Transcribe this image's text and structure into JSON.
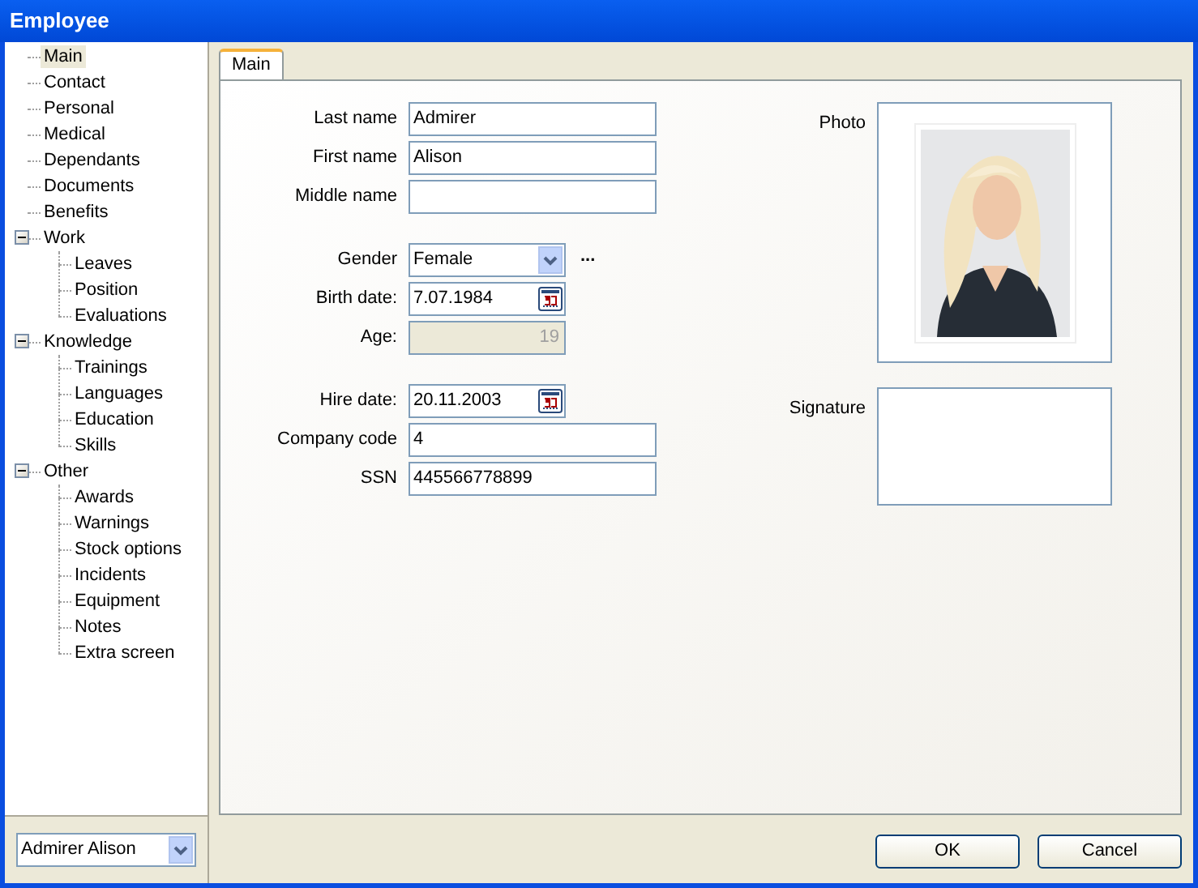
{
  "window": {
    "title": "Employee"
  },
  "tree": [
    {
      "label": "Main",
      "selected": true
    },
    {
      "label": "Contact",
      "selected": false
    },
    {
      "label": "Personal",
      "selected": false
    },
    {
      "label": "Medical",
      "selected": false
    },
    {
      "label": "Dependants",
      "selected": false
    },
    {
      "label": "Documents",
      "selected": false
    },
    {
      "label": "Benefits",
      "selected": false
    },
    {
      "label": "Work",
      "selected": false,
      "expanded": true,
      "children": [
        {
          "label": "Leaves",
          "selected": false
        },
        {
          "label": "Position",
          "selected": false
        },
        {
          "label": "Evaluations",
          "selected": false
        }
      ]
    },
    {
      "label": "Knowledge",
      "selected": false,
      "expanded": true,
      "children": [
        {
          "label": "Trainings",
          "selected": false
        },
        {
          "label": "Languages",
          "selected": false
        },
        {
          "label": "Education",
          "selected": false
        },
        {
          "label": "Skills",
          "selected": false
        }
      ]
    },
    {
      "label": "Other",
      "selected": false,
      "expanded": true,
      "children": [
        {
          "label": "Awards",
          "selected": false
        },
        {
          "label": "Warnings",
          "selected": false
        },
        {
          "label": "Stock options",
          "selected": false
        },
        {
          "label": "Incidents",
          "selected": false
        },
        {
          "label": "Equipment",
          "selected": false
        },
        {
          "label": "Notes",
          "selected": false
        },
        {
          "label": "Extra screen",
          "selected": false
        }
      ]
    }
  ],
  "employee_select": {
    "value": "Admirer Alison"
  },
  "tabs": [
    {
      "label": "Main",
      "selected": true
    }
  ],
  "field_groups": [
    [
      {
        "label": "Last name",
        "kind": "text",
        "value": "Admirer"
      },
      {
        "label": "First name",
        "kind": "text",
        "value": "Alison"
      },
      {
        "label": "Middle name",
        "kind": "text"
      }
    ],
    [
      {
        "label": "Gender",
        "kind": "select",
        "value": "Female",
        "extra": "..."
      },
      {
        "label": "Birth date:",
        "kind": "date",
        "value": "7.07.1984"
      },
      {
        "label": "Age:",
        "kind": "readonly",
        "value": "19",
        "disabled": true
      }
    ],
    [
      {
        "label": "Hire date:",
        "kind": "date",
        "value": "20.11.2003"
      },
      {
        "label": "Company code",
        "kind": "text",
        "value": "4"
      },
      {
        "label": "SSN",
        "kind": "text",
        "value": "445566778899"
      }
    ]
  ],
  "photo": {
    "label": "Photo",
    "kind": "picture"
  },
  "signature": {
    "label": "Signature"
  },
  "buttons": [
    "OK",
    "Cancel"
  ]
}
